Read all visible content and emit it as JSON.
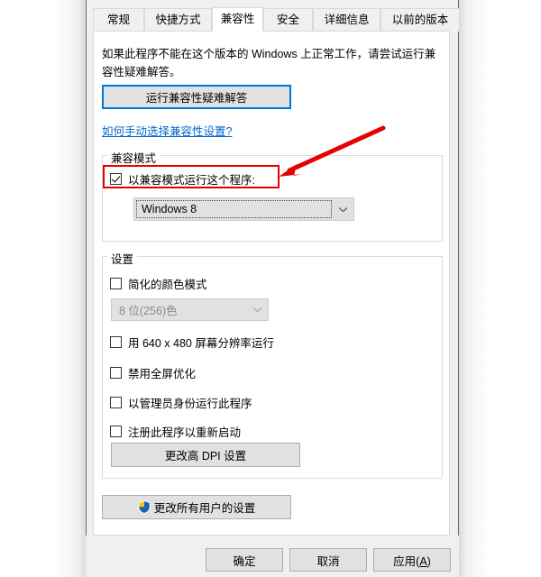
{
  "window": {
    "active_tab": "兼容性"
  },
  "tabs": [
    {
      "label": "常规",
      "name": "tab-general"
    },
    {
      "label": "快捷方式",
      "name": "tab-shortcut"
    },
    {
      "label": "兼容性",
      "name": "tab-compatibility"
    },
    {
      "label": "安全",
      "name": "tab-security"
    },
    {
      "label": "详细信息",
      "name": "tab-details"
    },
    {
      "label": "以前的版本",
      "name": "tab-previous-versions"
    }
  ],
  "page": {
    "description": "如果此程序不能在这个版本的 Windows 上正常工作，请尝试运行兼容性疑难解答。",
    "troubleshoot_button": "运行兼容性疑难解答",
    "help_link": "如何手动选择兼容性设置?"
  },
  "compatibility_group": {
    "title": "兼容模式",
    "checkbox_label": "以兼容模式运行这个程序:",
    "checkbox_checked": true,
    "mode_value": "Windows 8"
  },
  "settings_group": {
    "title": "设置",
    "reduced_color_label": "简化的颜色模式",
    "reduced_color_checked": false,
    "color_depth_value": "8 位(256)色",
    "color_depth_disabled": true,
    "checkboxes": [
      {
        "label": "用 640 x 480 屏幕分辨率运行",
        "checked": false,
        "name": "checkbox-640x480"
      },
      {
        "label": "禁用全屏优化",
        "checked": false,
        "name": "checkbox-disable-fullscreen-optimizations"
      },
      {
        "label": "以管理员身份运行此程序",
        "checked": false,
        "name": "checkbox-run-as-administrator"
      },
      {
        "label": "注册此程序以重新启动",
        "checked": false,
        "name": "checkbox-register-for-restart"
      }
    ],
    "dpi_button": "更改高 DPI 设置"
  },
  "change_all_users_button": "更改所有用户的设置",
  "footer": {
    "ok": "确定",
    "cancel": "取消",
    "apply": "应用(A)"
  },
  "annotations": {
    "highlight_color": "#e60000",
    "arrow_color": "#e60000"
  },
  "icons": {
    "shield": "uac-shield-icon",
    "chevron": "chevron-down-icon"
  },
  "colors": {
    "focus_blue": "#0078d7",
    "link_blue": "#0066cc",
    "button_face": "#e1e1e1",
    "dialog_bg": "#f0f0f0"
  }
}
